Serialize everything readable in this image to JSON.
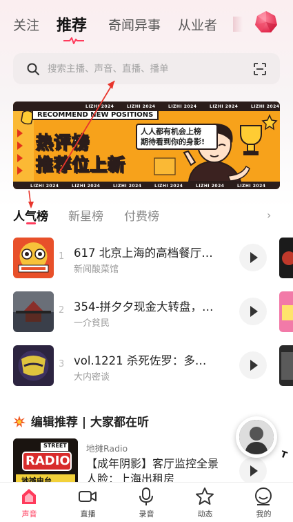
{
  "top_tabs": [
    {
      "label": "关注"
    },
    {
      "label": "推荐"
    },
    {
      "label": "奇闻异事"
    },
    {
      "label": "从业者"
    }
  ],
  "search": {
    "placeholder": "搜索主播、声音、直播、播单"
  },
  "banner": {
    "tag_text": "RECOMMEND NEW POSITIONS",
    "watermark": "LIZHI 2024",
    "headline_line1": "热评榜",
    "headline_line2": "推荐位上新",
    "bubble_line1": "人人都有机会上榜",
    "bubble_line2": "期待看到你的身影!"
  },
  "rank_tabs": [
    {
      "label": "人气榜"
    },
    {
      "label": "新星榜"
    },
    {
      "label": "付费榜"
    }
  ],
  "rank_more": "›",
  "ranking": [
    {
      "rank": "1",
      "title": "617 北京上海的高档餐厅…",
      "author": "新闻酸菜馆"
    },
    {
      "rank": "2",
      "title": "354-拼夕夕现金大转盘，…",
      "author": "一介貧民"
    },
    {
      "rank": "3",
      "title": "vol.1221 杀死佐罗：多…",
      "author": "大内密谈"
    }
  ],
  "editor": {
    "section_title": "编辑推荐 | 大家都在听",
    "source": "地摊Radio",
    "title": "【成年阴影】客厅监控全景人脸：上海出租房",
    "cover_text_top": "STREET",
    "cover_text_big": "RADIO",
    "cover_text_bottom": "地摊电台"
  },
  "bottom_nav": [
    {
      "label": "声音"
    },
    {
      "label": "直播"
    },
    {
      "label": "录音"
    },
    {
      "label": "动态"
    },
    {
      "label": "我的"
    }
  ],
  "colors": {
    "accent": "#ff3b5c",
    "banner_orange": "#f7a21b",
    "banner_dark": "#2b1d1b"
  }
}
